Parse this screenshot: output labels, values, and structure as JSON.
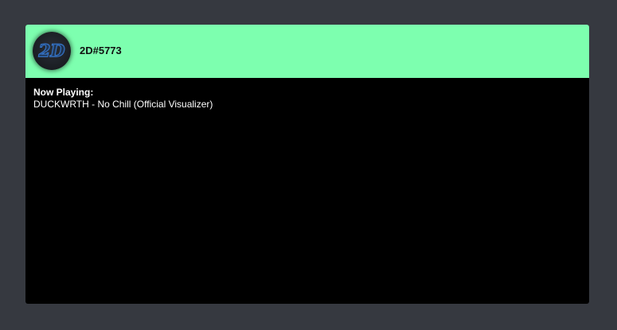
{
  "profile": {
    "avatar_icon": "2d-logo-avatar",
    "avatar_text": "2D",
    "username": "2D#5773"
  },
  "activity": {
    "label": "Now Playing:",
    "track": "DUCKWRTH - No Chill (Official Visualizer)"
  },
  "colors": {
    "page_background": "#363940",
    "header_background": "#7dffaf",
    "card_background": "#000000",
    "logo_blue": "#3b7fd9"
  }
}
